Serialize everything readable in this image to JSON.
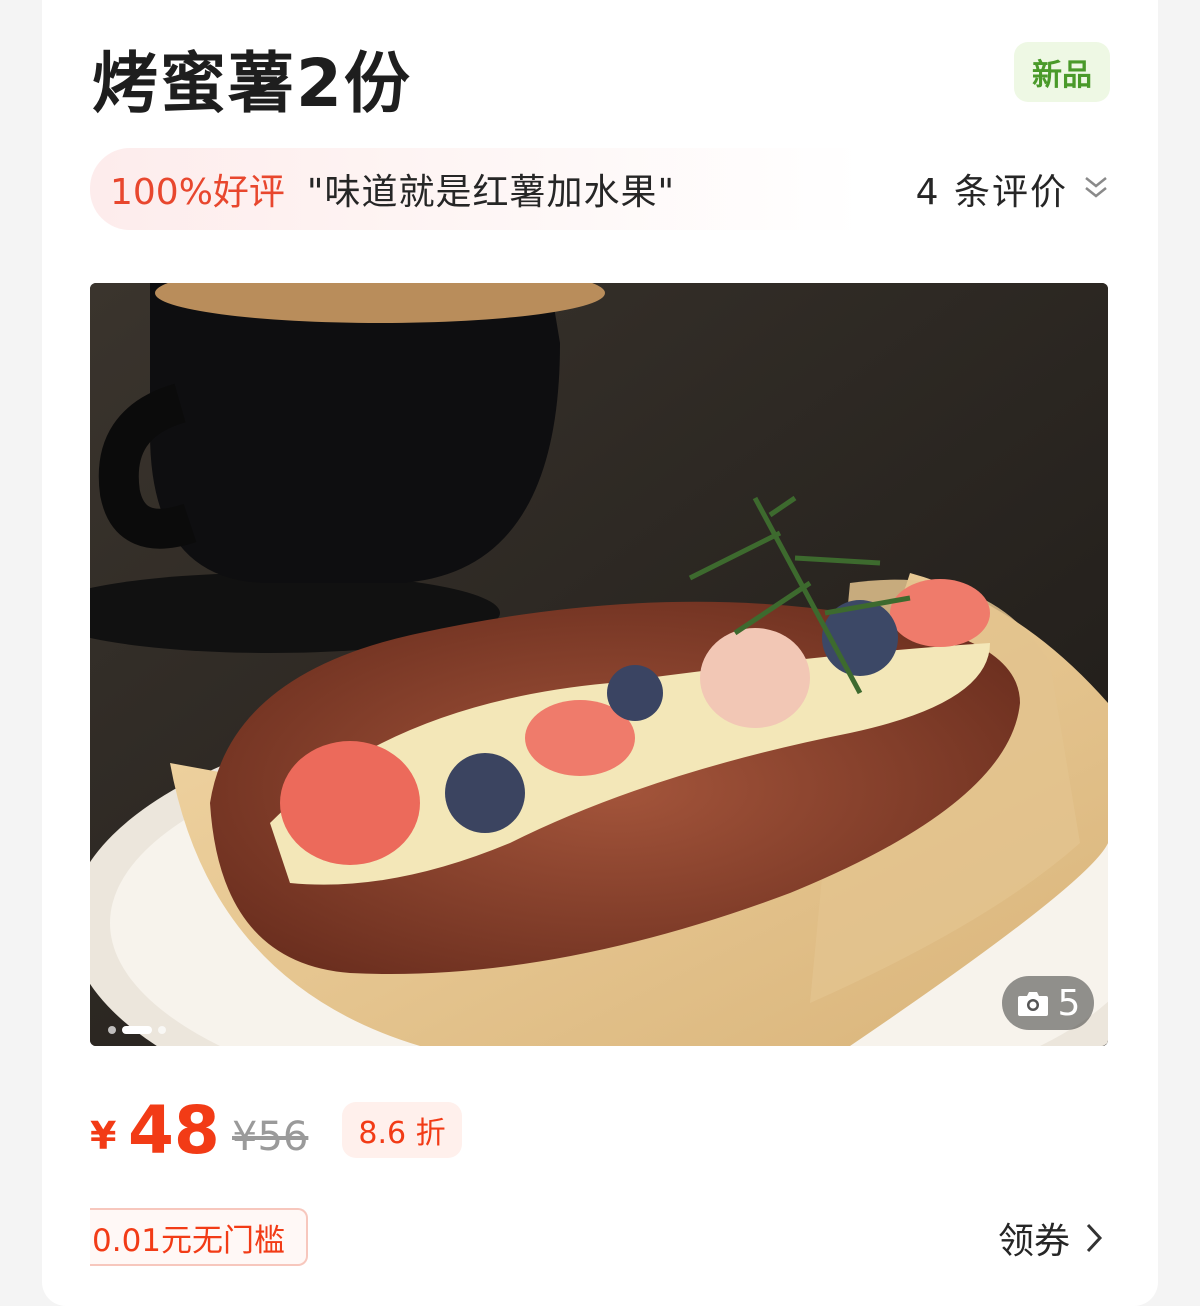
{
  "product": {
    "title": "烤蜜薯2份",
    "badge": "新品"
  },
  "reviews": {
    "rating": "100%好评",
    "quote": "\"味道就是红薯加水果\"",
    "count_label": "4 条评价"
  },
  "gallery": {
    "photo_count": "5",
    "current_index": 2,
    "dot_count": 3
  },
  "pricing": {
    "currency": "¥",
    "price": "48",
    "original_price": "¥56",
    "discount": "8.6 折"
  },
  "coupon": {
    "label": "0.01元无门槛",
    "action": "领券"
  },
  "colors": {
    "price_red": "#f23b16",
    "new_badge_green": "#4a9a2a"
  }
}
